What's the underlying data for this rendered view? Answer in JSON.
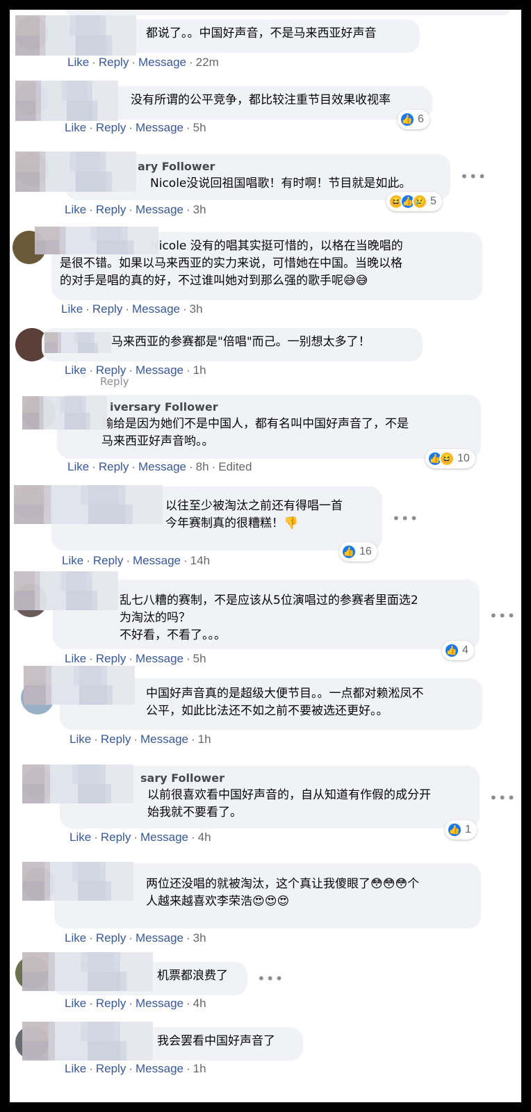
{
  "comments": [
    {
      "text": "都说了。。中国好声音，不是马来西亚好声音",
      "meta": {
        "like": "Like",
        "reply": "Reply",
        "message": "Message",
        "time": "22m"
      }
    },
    {
      "text": "没有所谓的公平竞争，都比较注重节目效果收视率",
      "meta": {
        "like": "Like",
        "reply": "Reply",
        "message": "Message",
        "time": "5h"
      },
      "reactions": {
        "count": "6",
        "icons": [
          "like"
        ]
      }
    },
    {
      "badge": "ary Follower",
      "text": "Nicole没说回祖国唱歌！有时啊！节目就是如此。",
      "meta": {
        "like": "Like",
        "reply": "Reply",
        "message": "Message",
        "time": "3h"
      },
      "reactions": {
        "count": "5",
        "icons": [
          "haha",
          "like",
          "sad"
        ]
      },
      "more": "•••"
    },
    {
      "text": "Nicole 没有的唱其实挺可惜的，以格在当晚唱的\n是很不错。如果以马来西亚的实力来说，可惜她在中国。当晚以格\n的对手是唱的真的好，不过谁叫她对到那么强的歌手呢😅😅",
      "meta": {
        "like": "Like",
        "reply": "Reply",
        "message": "Message",
        "time": "3h"
      }
    },
    {
      "text": "马来西亚的参赛都是\"倍唱\"而己。一别想太多了！",
      "meta": {
        "like": "Like",
        "reply": "Reply",
        "message": "Message",
        "time": "1h"
      },
      "ghost": "Reply"
    },
    {
      "badge": "iversary Follower",
      "text": "输给是因为她们不是中国人，都有名叫中国好声音了，不是\n马来西亚好声音哟。。",
      "meta": {
        "like": "Like",
        "reply": "Reply",
        "message": "Message",
        "time": "8h",
        "edited": "Edited"
      },
      "reactions": {
        "count": "10",
        "icons": [
          "like",
          "haha"
        ]
      }
    },
    {
      "text": "以往至少被淘汰之前还有得唱一首\n今年赛制真的很糟糕！👎",
      "meta": {
        "like": "Like",
        "reply": "Reply",
        "message": "Message",
        "time": "14h"
      },
      "reactions": {
        "count": "16",
        "icons": [
          "like"
        ]
      },
      "more": "•••"
    },
    {
      "text": "乱七八糟的赛制，不是应该从5位演唱过的参赛者里面选2\n为淘汰的吗？\n不好看，不看了。。。",
      "meta": {
        "like": "Like",
        "reply": "Reply",
        "message": "Message",
        "time": "5h"
      },
      "reactions": {
        "count": "4",
        "icons": [
          "like"
        ]
      },
      "more": "•••"
    },
    {
      "text": "中国好声音真的是超级大便节目。。一点都对赖淞凤不\n公平，如此比法还不如之前不要被选还更好。。",
      "meta": {
        "like": "Like",
        "reply": "Reply",
        "message": "Message",
        "time": "1h"
      }
    },
    {
      "badge": "sary Follower",
      "text": "以前很喜欢看中国好声音的，自从知道有作假的成分开\n始我就不要看了。",
      "meta": {
        "like": "Like",
        "reply": "Reply",
        "message": "Message",
        "time": "4h"
      },
      "reactions": {
        "count": "1",
        "icons": [
          "like"
        ]
      },
      "more": "•••"
    },
    {
      "text": "两位还没唱的就被淘汰，这个真让我傻眼了😳😳😳个\n人越来越喜欢李荣浩😍😍😍",
      "meta": {
        "like": "Like",
        "reply": "Reply",
        "message": "Message",
        "time": "3h"
      }
    },
    {
      "text": "机票都浪费了",
      "meta": {
        "like": "Like",
        "reply": "Reply",
        "message": "Message",
        "time": "4h"
      },
      "more": "•••"
    },
    {
      "text": "我会罢看中国好声音了",
      "meta": {
        "like": "Like",
        "reply": "Reply",
        "message": "Message",
        "time": "1h"
      }
    }
  ]
}
